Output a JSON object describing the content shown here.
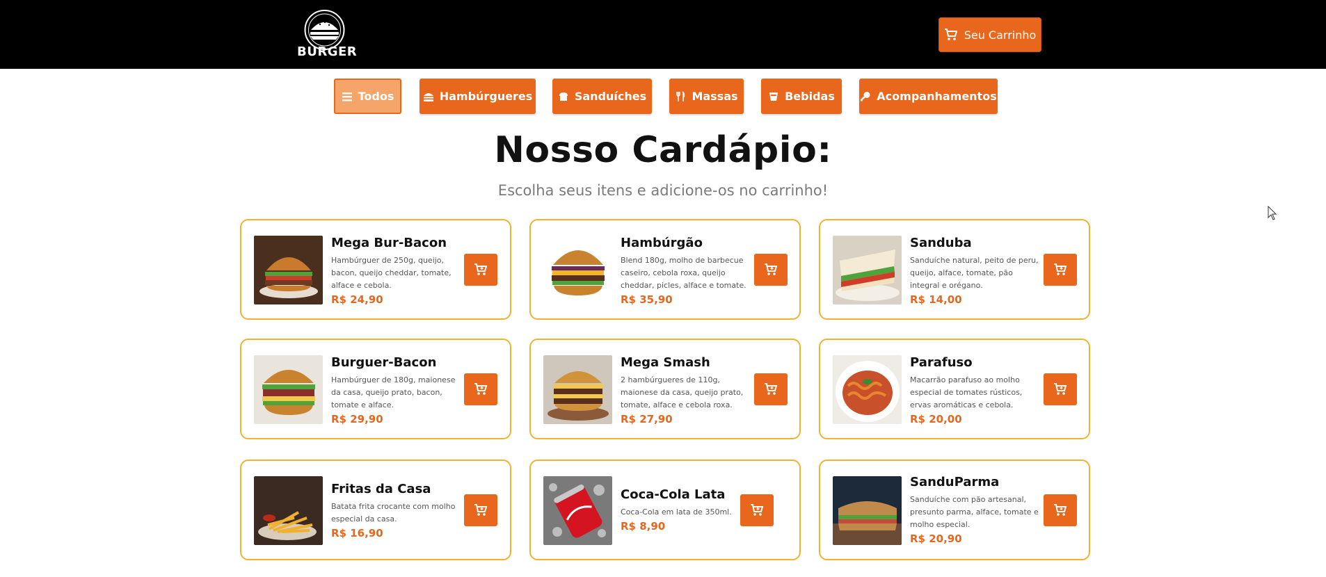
{
  "header": {
    "logo_text": "BURGER",
    "cart_button": {
      "label": "Seu Carrinho",
      "icon": "cart-icon"
    }
  },
  "filters": [
    {
      "label": "Todos",
      "icon": "menu-icon",
      "active": true
    },
    {
      "label": "Hambúrgueres",
      "icon": "burger-icon",
      "active": false
    },
    {
      "label": "Sanduíches",
      "icon": "bread-icon",
      "active": false
    },
    {
      "label": "Massas",
      "icon": "utensils-icon",
      "active": false
    },
    {
      "label": "Bebidas",
      "icon": "drink-icon",
      "active": false
    },
    {
      "label": "Acompanhamentos",
      "icon": "drumstick-icon",
      "active": false
    }
  ],
  "menu": {
    "title": "Nosso Cardápio:",
    "subtitle": "Escolha seus itens e adicione-os no carrinho!",
    "items": [
      {
        "name": "Mega Bur-Bacon",
        "desc": "Hambúrguer de 250g, queijo, bacon, queijo cheddar, tomate, alface e cebola.",
        "price": "R$ 24,90",
        "image": "burger-photo"
      },
      {
        "name": "Hambúrgão",
        "desc": "Blend 180g, molho de barbecue caseiro, cebola roxa, queijo cheddar, picles, alface e tomate.",
        "price": "R$ 35,90",
        "image": "burger-photo"
      },
      {
        "name": "Sanduba",
        "desc": "Sanduíche natural, peito de peru, queijo, alface, tomate, pão integral e orégano.",
        "price": "R$ 14,00",
        "image": "sandwich-photo"
      },
      {
        "name": "Burguer-Bacon",
        "desc": "Hambúrguer de 180g, maionese da casa, queijo prato, bacon, tomate e alface.",
        "price": "R$ 29,90",
        "image": "burger-photo"
      },
      {
        "name": "Mega Smash",
        "desc": "2 hambúrgueres de 110g, maionese da casa, queijo prato, tomate, alface e cebola roxa.",
        "price": "R$ 27,90",
        "image": "burger-photo"
      },
      {
        "name": "Parafuso",
        "desc": "Macarrão parafuso ao molho especial de tomates rústicos, ervas aromáticas e cebola.",
        "price": "R$ 20,00",
        "image": "pasta-photo"
      },
      {
        "name": "Fritas da Casa",
        "desc": "Batata frita crocante com molho especial da casa.",
        "price": "R$ 16,90",
        "image": "fries-photo"
      },
      {
        "name": "Coca-Cola Lata",
        "desc": "Coca-Cola em lata de 350ml.",
        "price": "R$ 8,90",
        "image": "soda-can-photo"
      },
      {
        "name": "SanduParma",
        "desc": "Sanduíche com pão artesanal, presunto parma, alface, tomate e molho especial.",
        "price": "R$ 20,90",
        "image": "sandwich-photo"
      }
    ]
  },
  "colors": {
    "accent": "#e8671d",
    "card_border": "#f1b22f",
    "header_bg": "#000000"
  }
}
